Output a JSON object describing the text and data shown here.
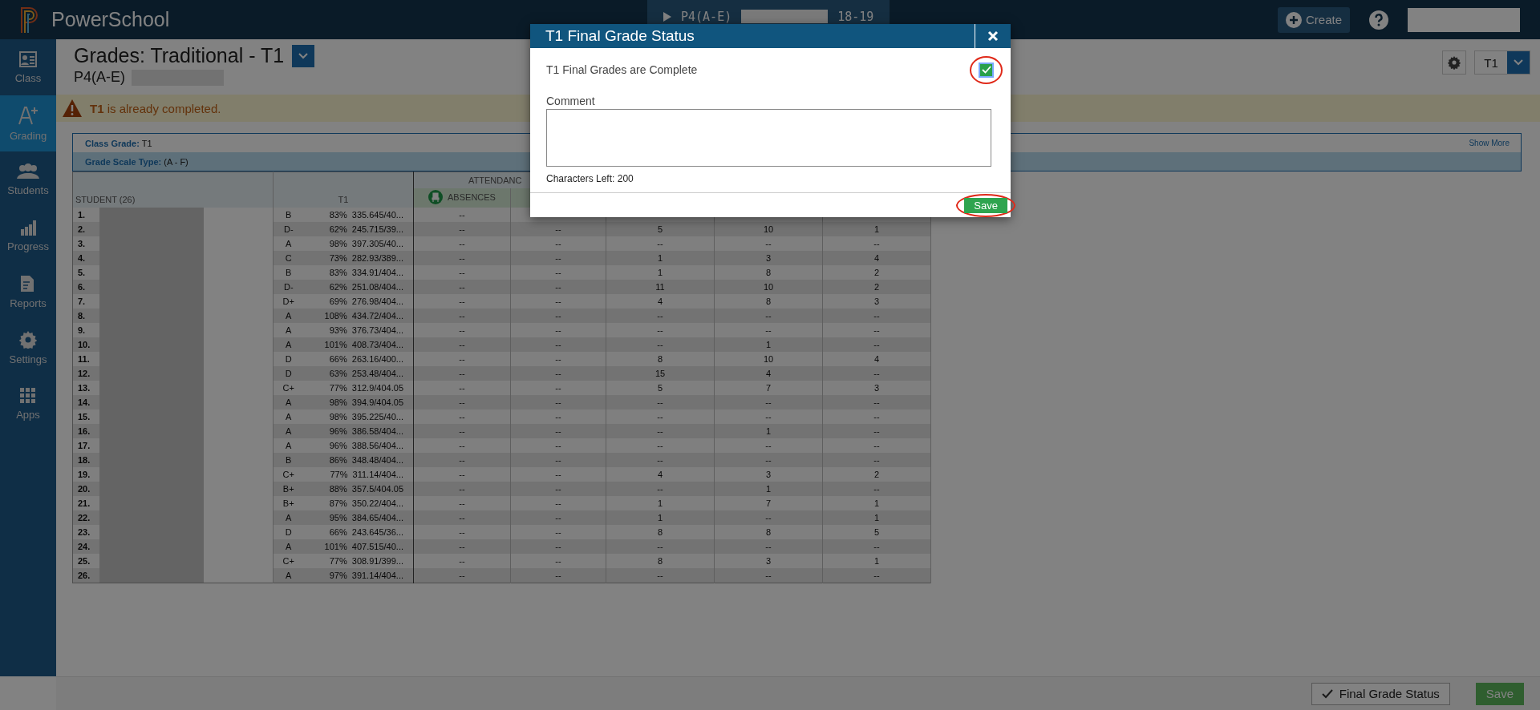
{
  "topbar": {
    "brand": "PowerSchool",
    "section_tab": {
      "label": "P4(A-E)",
      "term": "18-19"
    },
    "create_button": "Create"
  },
  "sidebar": {
    "items": [
      {
        "kind": "class",
        "label": "Class",
        "selected": false
      },
      {
        "kind": "grading",
        "label": "Grading",
        "selected": true
      },
      {
        "kind": "students",
        "label": "Students",
        "selected": false
      },
      {
        "kind": "progress",
        "label": "Progress",
        "selected": false
      },
      {
        "kind": "reports",
        "label": "Reports",
        "selected": false
      },
      {
        "kind": "settings",
        "label": "Settings",
        "selected": false
      },
      {
        "kind": "apps",
        "label": "Apps",
        "selected": false
      }
    ]
  },
  "header": {
    "title": "Grades: Traditional - T1",
    "subtitle": "P4(A-E)",
    "term_select": "T1"
  },
  "alert": {
    "message": "**T1** is already completed."
  },
  "class_info": {
    "class_grade_label": "Class Grade:",
    "class_grade": "T1",
    "show_more": "Show More",
    "scale_label": "Grade Scale Type:",
    "scale": "(A - F)"
  },
  "table": {
    "student_header": "STUDENT (26)",
    "term_header": "T1",
    "group_header": "ATTENDANC",
    "absences_header": "ABSENCES",
    "rows": [
      {
        "num": "1.",
        "grade": "B",
        "percent": "83%",
        "points": "335.645/40...",
        "attendance": [
          "--"
        ]
      },
      {
        "num": "2.",
        "grade": "D-",
        "percent": "62%",
        "points": "245.715/39...",
        "attendance": [
          "--",
          "--",
          "5",
          "10",
          "1"
        ]
      },
      {
        "num": "3.",
        "grade": "A",
        "percent": "98%",
        "points": "397.305/40...",
        "attendance": [
          "--",
          "--",
          "--",
          "--",
          "--"
        ]
      },
      {
        "num": "4.",
        "grade": "C",
        "percent": "73%",
        "points": "282.93/389...",
        "attendance": [
          "--",
          "--",
          "1",
          "3",
          "4"
        ]
      },
      {
        "num": "5.",
        "grade": "B",
        "percent": "83%",
        "points": "334.91/404...",
        "attendance": [
          "--",
          "--",
          "1",
          "8",
          "2"
        ]
      },
      {
        "num": "6.",
        "grade": "D-",
        "percent": "62%",
        "points": "251.08/404...",
        "attendance": [
          "--",
          "--",
          "11",
          "10",
          "2"
        ]
      },
      {
        "num": "7.",
        "grade": "D+",
        "percent": "69%",
        "points": "276.98/404...",
        "attendance": [
          "--",
          "--",
          "4",
          "8",
          "3"
        ]
      },
      {
        "num": "8.",
        "grade": "A",
        "percent": "108%",
        "points": "434.72/404...",
        "attendance": [
          "--",
          "--",
          "--",
          "--",
          "--"
        ]
      },
      {
        "num": "9.",
        "grade": "A",
        "percent": "93%",
        "points": "376.73/404...",
        "attendance": [
          "--",
          "--",
          "--",
          "--",
          "--"
        ]
      },
      {
        "num": "10.",
        "grade": "A",
        "percent": "101%",
        "points": "408.73/404...",
        "attendance": [
          "--",
          "--",
          "--",
          "1",
          "--"
        ]
      },
      {
        "num": "11.",
        "grade": "D",
        "percent": "66%",
        "points": "263.16/400...",
        "attendance": [
          "--",
          "--",
          "8",
          "10",
          "4"
        ]
      },
      {
        "num": "12.",
        "grade": "D",
        "percent": "63%",
        "points": "253.48/404...",
        "attendance": [
          "--",
          "--",
          "15",
          "4",
          "--"
        ]
      },
      {
        "num": "13.",
        "grade": "C+",
        "percent": "77%",
        "points": "312.9/404.05",
        "attendance": [
          "--",
          "--",
          "5",
          "7",
          "3"
        ]
      },
      {
        "num": "14.",
        "grade": "A",
        "percent": "98%",
        "points": "394.9/404.05",
        "attendance": [
          "--",
          "--",
          "--",
          "--",
          "--"
        ]
      },
      {
        "num": "15.",
        "grade": "A",
        "percent": "98%",
        "points": "395.225/40...",
        "attendance": [
          "--",
          "--",
          "--",
          "--",
          "--"
        ]
      },
      {
        "num": "16.",
        "grade": "A",
        "percent": "96%",
        "points": "386.58/404...",
        "attendance": [
          "--",
          "--",
          "--",
          "1",
          "--"
        ]
      },
      {
        "num": "17.",
        "grade": "A",
        "percent": "96%",
        "points": "388.56/404...",
        "attendance": [
          "--",
          "--",
          "--",
          "--",
          "--"
        ]
      },
      {
        "num": "18.",
        "grade": "B",
        "percent": "86%",
        "points": "348.48/404...",
        "attendance": [
          "--",
          "--",
          "--",
          "--",
          "--"
        ]
      },
      {
        "num": "19.",
        "grade": "C+",
        "percent": "77%",
        "points": "311.14/404...",
        "attendance": [
          "--",
          "--",
          "4",
          "3",
          "2"
        ]
      },
      {
        "num": "20.",
        "grade": "B+",
        "percent": "88%",
        "points": "357.5/404.05",
        "attendance": [
          "--",
          "--",
          "--",
          "1",
          "--"
        ]
      },
      {
        "num": "21.",
        "grade": "B+",
        "percent": "87%",
        "points": "350.22/404...",
        "attendance": [
          "--",
          "--",
          "1",
          "7",
          "1"
        ]
      },
      {
        "num": "22.",
        "grade": "A",
        "percent": "95%",
        "points": "384.65/404...",
        "attendance": [
          "--",
          "--",
          "1",
          "--",
          "1"
        ]
      },
      {
        "num": "23.",
        "grade": "D",
        "percent": "66%",
        "points": "243.645/36...",
        "attendance": [
          "--",
          "--",
          "8",
          "8",
          "5"
        ]
      },
      {
        "num": "24.",
        "grade": "A",
        "percent": "101%",
        "points": "407.515/40...",
        "attendance": [
          "--",
          "--",
          "--",
          "--",
          "--"
        ]
      },
      {
        "num": "25.",
        "grade": "C+",
        "percent": "77%",
        "points": "308.91/399...",
        "attendance": [
          "--",
          "--",
          "8",
          "3",
          "1"
        ]
      },
      {
        "num": "26.",
        "grade": "A",
        "percent": "97%",
        "points": "391.14/404...",
        "attendance": [
          "--",
          "--",
          "--",
          "--",
          "--"
        ]
      }
    ]
  },
  "footer": {
    "status_button": "Final Grade Status",
    "save_button": "Save"
  },
  "modal": {
    "title": "T1 Final Grade Status",
    "complete_label": "T1 Final Grades are Complete",
    "checked": true,
    "comment_label": "Comment",
    "chars_left": "Characters Left: 200",
    "save_button": "Save"
  }
}
